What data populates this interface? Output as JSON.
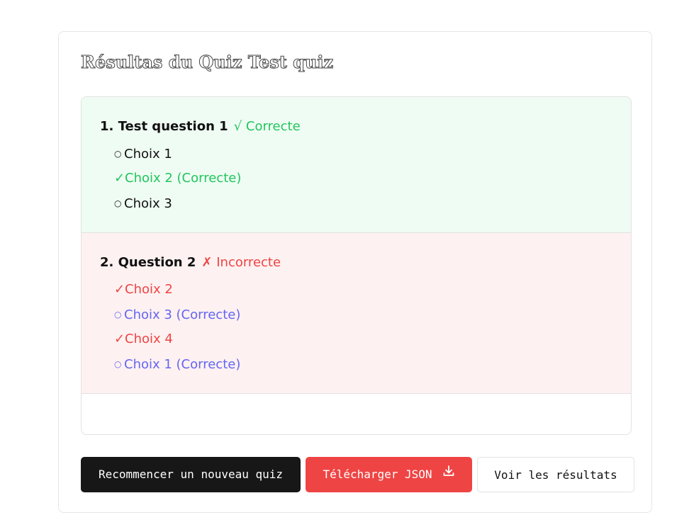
{
  "page": {
    "title": "Résultas du Quiz Test quiz"
  },
  "questions": [
    {
      "heading": "1. Test question 1",
      "status_label": "√ Correcte",
      "status": "correct",
      "choices": [
        {
          "mark": "○",
          "label": "Choix 1",
          "state": "neutral"
        },
        {
          "mark": "✓",
          "label": "Choix 2 (Correcte)",
          "state": "selected-correct"
        },
        {
          "mark": "○",
          "label": "Choix 3",
          "state": "neutral"
        }
      ]
    },
    {
      "heading": "2. Question 2",
      "status_label": "✗ Incorrecte",
      "status": "incorrect",
      "choices": [
        {
          "mark": "✓",
          "label": "Choix 2",
          "state": "selected-wrong"
        },
        {
          "mark": "○",
          "label": "Choix 3 (Correcte)",
          "state": "missed-correct"
        },
        {
          "mark": "✓",
          "label": "Choix 4",
          "state": "selected-wrong"
        },
        {
          "mark": "○",
          "label": "Choix 1 (Correcte)",
          "state": "missed-correct"
        }
      ]
    }
  ],
  "actions": {
    "restart_label": "Recommencer un nouveau quiz",
    "download_label": "Télécharger JSON",
    "view_label": "Voir les résultats",
    "download_icon": "download-icon"
  },
  "colors": {
    "correct": "#22c55e",
    "incorrect": "#ef4444",
    "missed": "#6366f1",
    "correct_bg": "#effcf3",
    "incorrect_bg": "#fef1f1"
  }
}
